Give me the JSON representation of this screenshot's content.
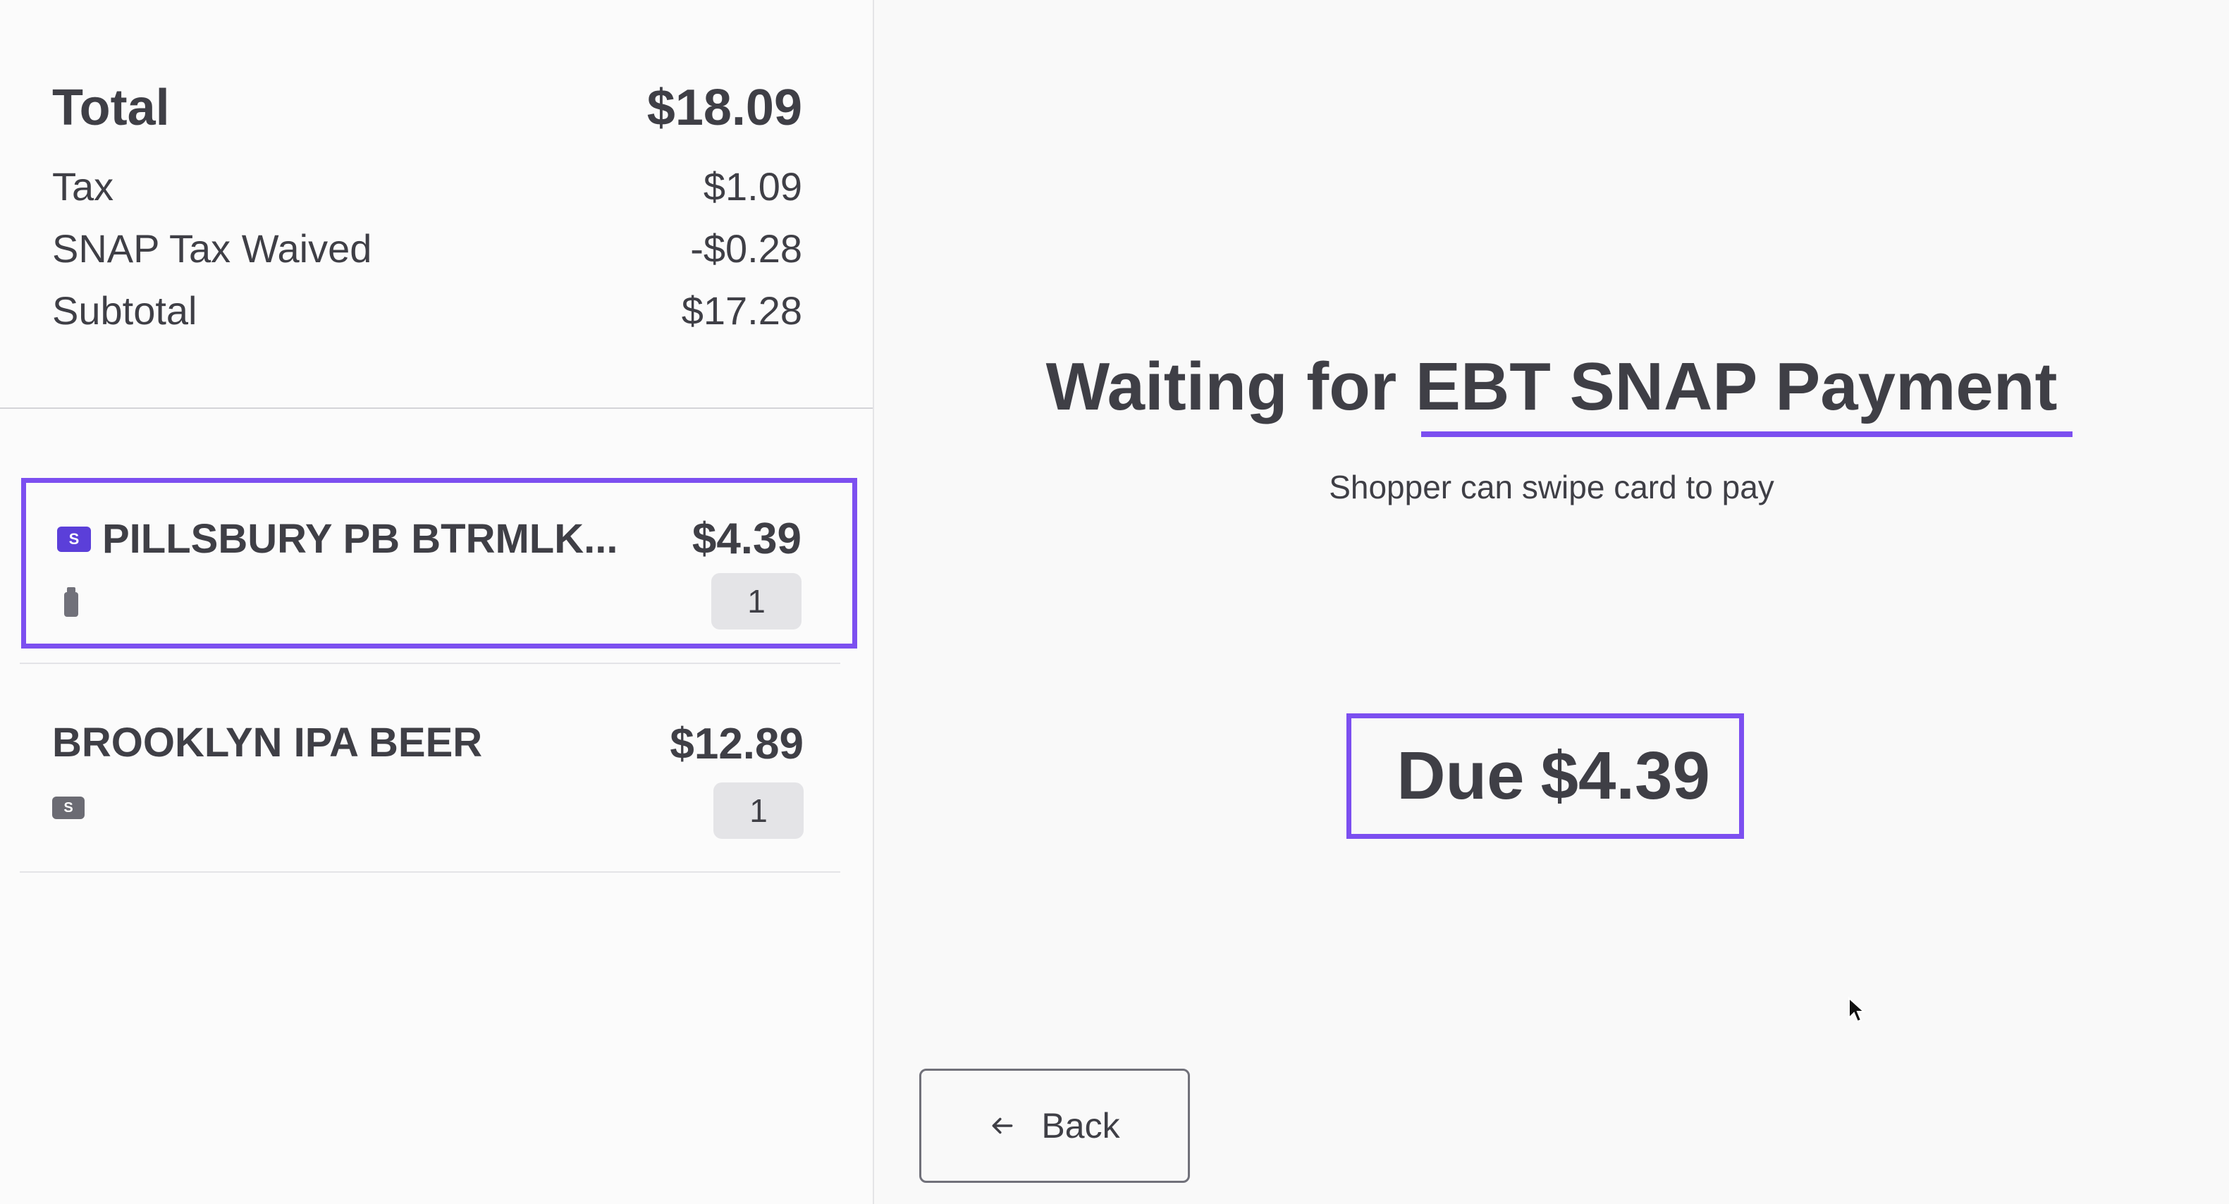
{
  "summary": {
    "total_label": "Total",
    "total_value": "$18.09",
    "tax_label": "Tax",
    "tax_value": "$1.09",
    "snap_label": "SNAP Tax Waived",
    "snap_value": "-$0.28",
    "subtotal_label": "Subtotal",
    "subtotal_value": "$17.28"
  },
  "items": [
    {
      "name": "PILLSBURY PB BTRMLK...",
      "price": "$4.39",
      "badge": "S",
      "qty": "1",
      "selected": true,
      "icon": "bottle-icon"
    },
    {
      "name": "BROOKLYN IPA BEER",
      "price": "$12.89",
      "badge": "S",
      "qty": "1",
      "selected": false
    }
  ],
  "payment": {
    "title_prefix": "Waiting for",
    "title_highlight": "EBT SNAP Payment",
    "subtitle": "Shopper can swipe card to pay",
    "due_label": "Due",
    "due_amount": "$4.39"
  },
  "back_button": {
    "label": "Back",
    "icon": "arrow-left-icon"
  },
  "colors": {
    "accent": "#7c4ff0",
    "snap_badge": "#5b3fd9",
    "text": "#3f3f46"
  }
}
